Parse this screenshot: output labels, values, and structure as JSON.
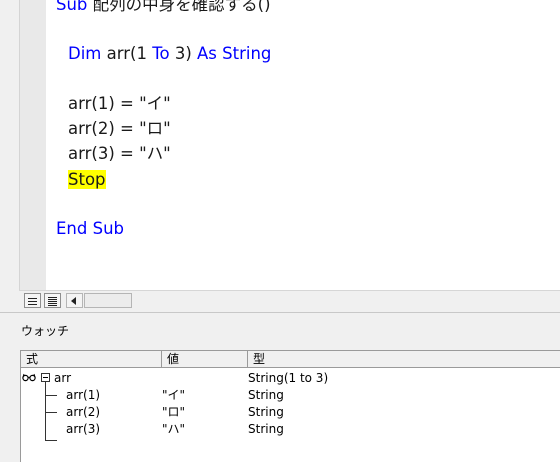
{
  "code_window": {
    "lines": {
      "sub_header_kw": "Sub",
      "sub_header_rest": " 配列の中身を確認する()",
      "dim_kw1": "Dim",
      "dim_mid1": " arr(1 ",
      "dim_kw2": "To",
      "dim_mid2": " 3) ",
      "dim_kw3": "As String",
      "assign1": "arr(1) = \"イ\"",
      "assign2": "arr(2) = \"ロ\"",
      "assign3": "arr(3) = \"ハ\"",
      "stop": "Stop",
      "end_sub": "End Sub"
    },
    "highlight_color": "#ffff00",
    "keyword_color": "#0000ff",
    "execution_pointer_icon": "yellow-arrow-icon"
  },
  "watch_window": {
    "title": "ウォッチ",
    "columns": {
      "expression": "式",
      "value": "値",
      "type": "型"
    },
    "rows": [
      {
        "expression": "arr",
        "value": "",
        "type": "String(1 to 3)",
        "icon": "watch-glasses-icon",
        "expanded": true
      },
      {
        "expression": "arr(1)",
        "value": "\"イ\"",
        "type": "String"
      },
      {
        "expression": "arr(2)",
        "value": "\"ロ\"",
        "type": "String"
      },
      {
        "expression": "arr(3)",
        "value": "\"ハ\"",
        "type": "String"
      }
    ]
  }
}
